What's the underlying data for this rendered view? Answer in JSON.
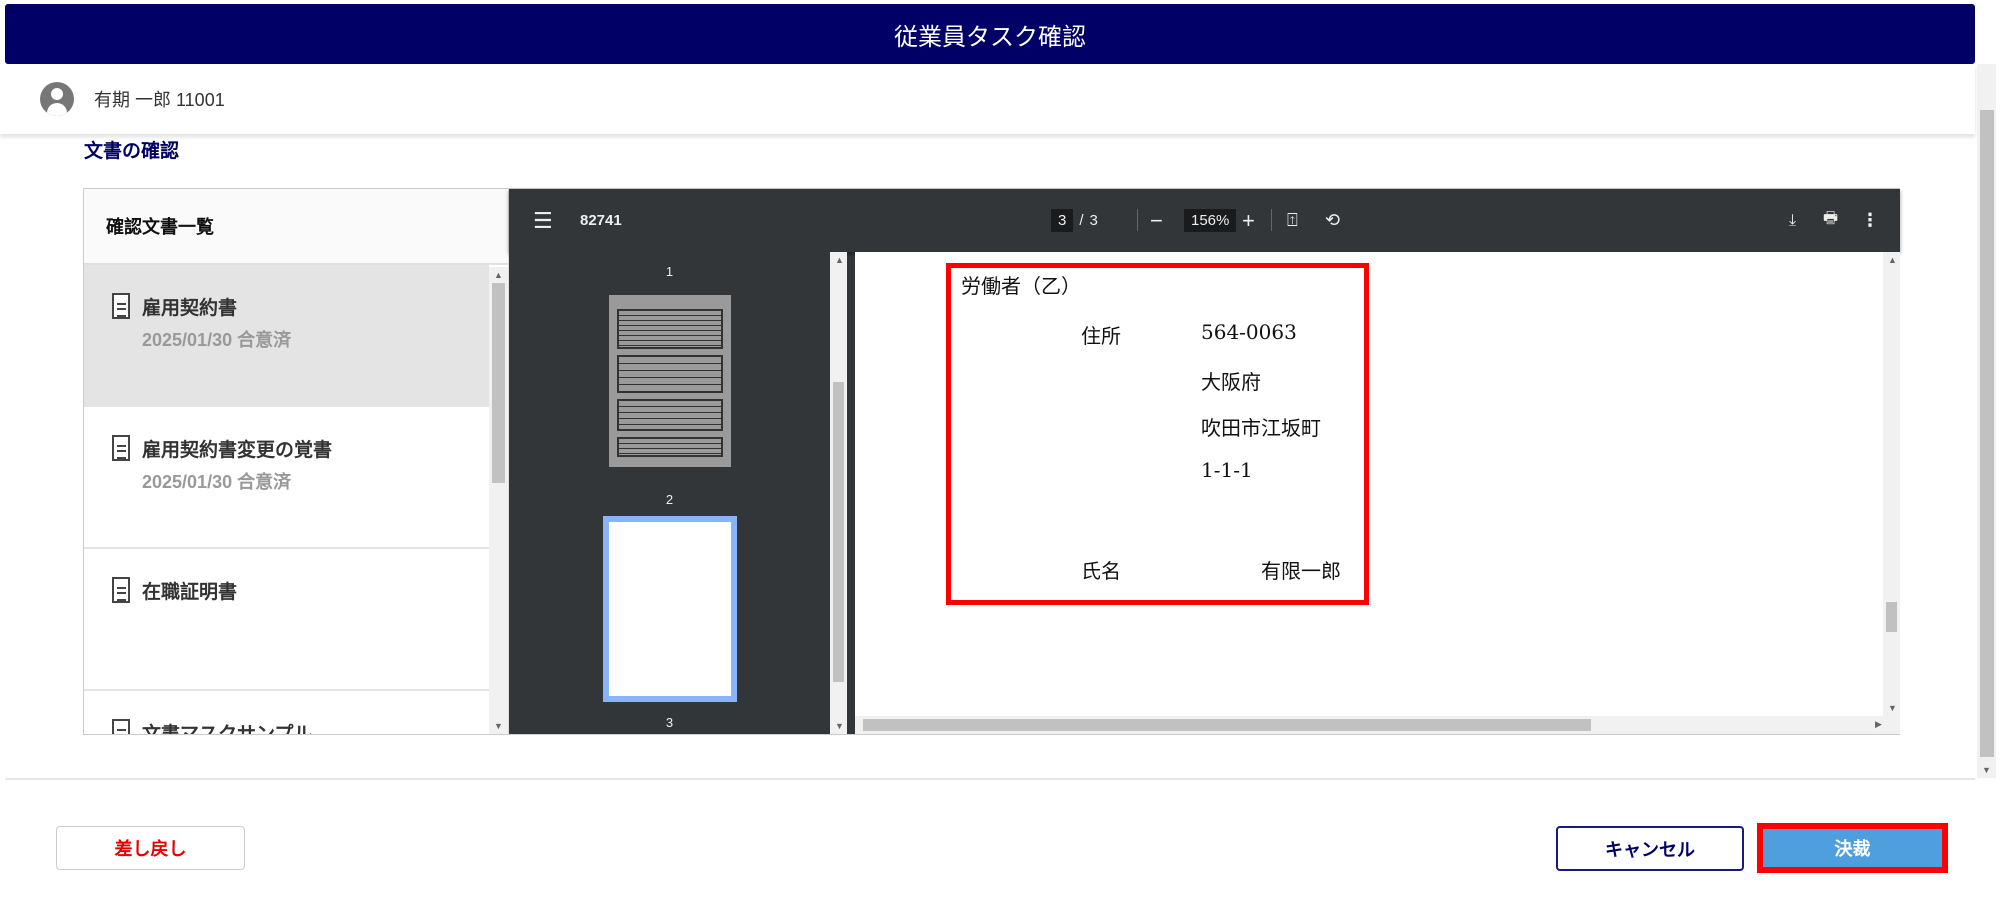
{
  "header": {
    "title": "従業員タスク確認"
  },
  "user": {
    "name": "有期 一郎 11001"
  },
  "section": {
    "title": "文書の確認"
  },
  "doc_list": {
    "title": "確認文書一覧",
    "items": [
      {
        "title": "雇用契約書",
        "status": "2025/01/30 合意済"
      },
      {
        "title": "雇用契約書変更の覚書",
        "status": "2025/01/30 合意済"
      },
      {
        "title": "在職証明書"
      },
      {
        "title": "文書マスクサンプル"
      }
    ]
  },
  "viewer": {
    "file_name": "82741",
    "current_page": "3",
    "page_sep": "/",
    "total_pages": "3",
    "zoom": "156%",
    "thumb_labels": [
      "1",
      "2",
      "3"
    ]
  },
  "document": {
    "heading": "労働者（乙）",
    "address_label": "住所",
    "postal": "564-0063",
    "prefecture": "大阪府",
    "city": "吹田市江坂町",
    "block": "1-1-1",
    "name_label": "氏名",
    "name": "有限一郎"
  },
  "actions": {
    "return": "差し戻し",
    "cancel": "キャンセル",
    "approve": "決裁"
  }
}
